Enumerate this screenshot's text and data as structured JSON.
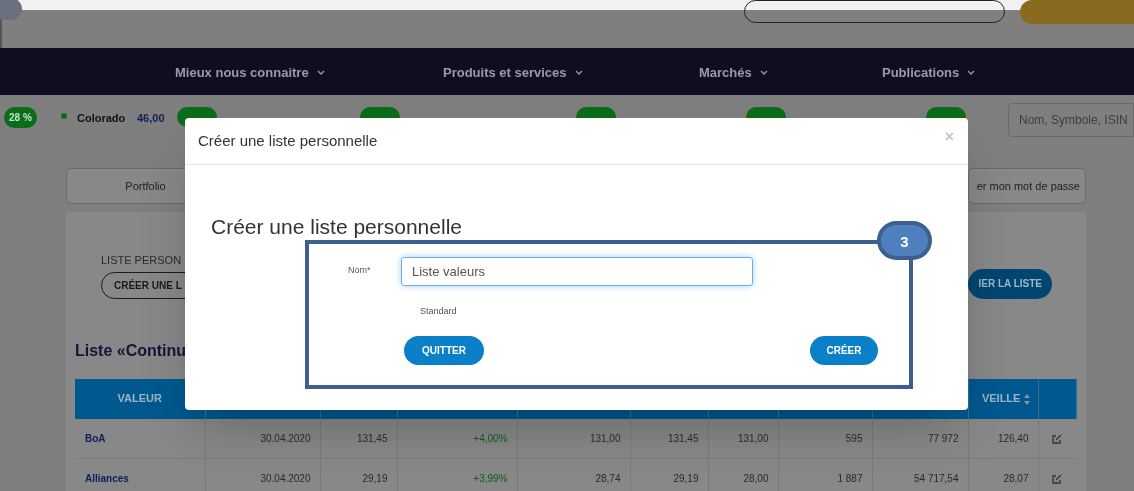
{
  "nav": {
    "items": [
      {
        "label": "Mieux nous connaitre"
      },
      {
        "label": "Produits et services"
      },
      {
        "label": "Marchés"
      },
      {
        "label": "Publications"
      }
    ]
  },
  "ticker": {
    "lead_change": "28 %",
    "items": [
      {
        "name": "Colorado",
        "price": "46,00"
      }
    ]
  },
  "search": {
    "placeholder": "Nom, Symbole, ISIN"
  },
  "tabs": [
    {
      "label": "Portfolio"
    },
    {
      "label": "er mon mot de passe"
    }
  ],
  "panel": {
    "section_label": "LISTE PERSON",
    "create_button": "CRÉER UNE L",
    "action_button": "IER LA LISTE",
    "list_title": "Liste «Continu"
  },
  "table": {
    "columns": [
      {
        "label": "VALEUR"
      },
      {},
      {},
      {},
      {},
      {},
      {},
      {},
      {},
      {
        "label": "VEILLE",
        "sortable": true
      },
      {}
    ],
    "rows": [
      {
        "cells": [
          "BoA",
          "30.04.2020",
          "131,45",
          "+4,00%",
          "131,00",
          "131,45",
          "131,00",
          "595",
          "77 972",
          "126,40"
        ]
      },
      {
        "cells": [
          "Alliances",
          "30.04.2020",
          "29,19",
          "+3,99%",
          "28,74",
          "29,19",
          "28,00",
          "1 887",
          "54 717,54",
          "28,07"
        ]
      }
    ]
  },
  "modal": {
    "title": "Créer une liste personnelle",
    "close": "×",
    "heading": "Créer une liste personnelle",
    "name_label": "Nom*",
    "name_value": "Liste valeurs",
    "type_label": "Standard",
    "buttons": [
      {
        "label": "QUITTER"
      },
      {
        "label": "CRÉER"
      }
    ]
  },
  "annotation": {
    "number": "3"
  }
}
